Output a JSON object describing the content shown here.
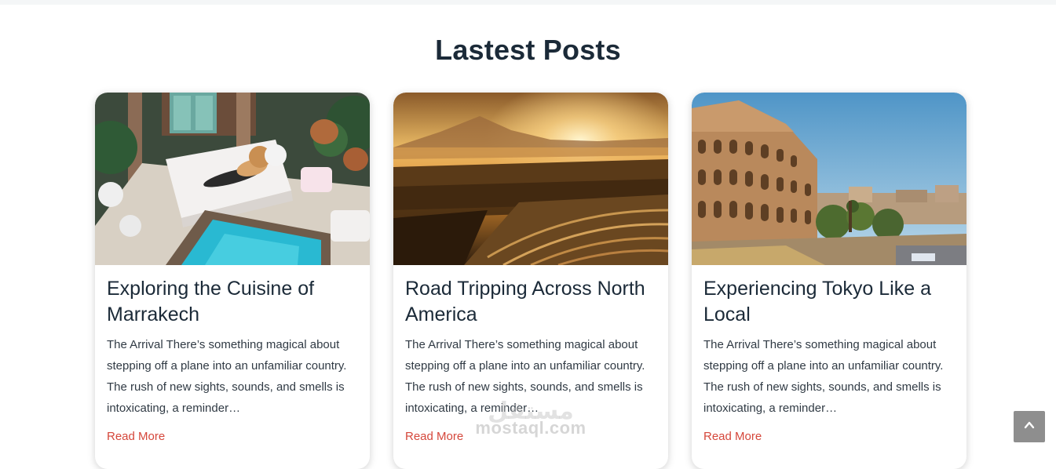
{
  "section": {
    "title": "Lastest Posts"
  },
  "posts": [
    {
      "title": "Exploring the Cuisine of Marrakech",
      "excerpt": "The Arrival There’s something magical about stepping off a plane into an unfamiliar country. The rush of new sights, sounds, and smells is intoxicating, a reminder…",
      "read_more": "Read More",
      "image_alt": "Riad courtyard with pool and lounge beds"
    },
    {
      "title": "Road Tripping Across North America",
      "excerpt": "The Arrival There’s something magical about stepping off a plane into an unfamiliar country. The rush of new sights, sounds, and smells is intoxicating, a reminder…",
      "read_more": "Read More",
      "image_alt": "Golden sunrise over terraced valley and mountains"
    },
    {
      "title": "Experiencing Tokyo Like a Local",
      "excerpt": "The Arrival There’s something magical about stepping off a plane into an unfamiliar country. The rush of new sights, sounds, and smells is intoxicating, a reminder…",
      "read_more": "Read More",
      "image_alt": "The Colosseum under a blue sky"
    }
  ],
  "watermark": {
    "arabic": "مستقل",
    "latin": "mostaql.com"
  },
  "back_to_top": {
    "icon": "chevron-up-icon"
  },
  "colors": {
    "heading": "#1b2a38",
    "link": "#d5473b",
    "back_to_top_bg": "#8e8e8e"
  }
}
